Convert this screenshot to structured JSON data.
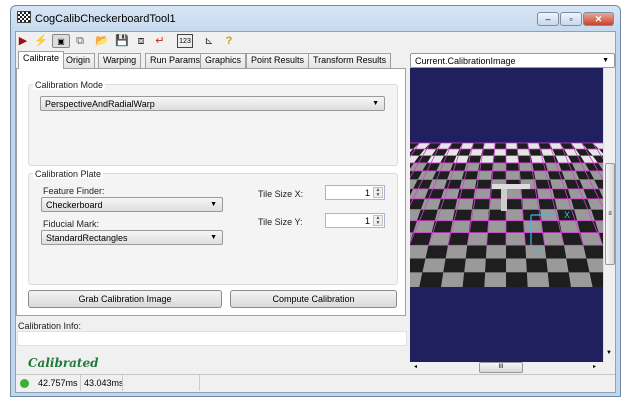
{
  "window": {
    "title": "CogCalibCheckerboardTool1",
    "icon": "checkerboard-icon",
    "buttons": [
      "minimize",
      "maximize",
      "close"
    ]
  },
  "toolbar": {
    "icons": [
      "run-icon",
      "electric-icon",
      "show-icon",
      "float-icon",
      "open-icon",
      "save-icon",
      "reset-icon",
      "import-icon",
      "numbers-icon",
      "tool-icon",
      "help-icon"
    ]
  },
  "tabs": [
    {
      "label": "Calibrate",
      "active": true
    },
    {
      "label": "Origin"
    },
    {
      "label": "Warping"
    },
    {
      "label": "Run Params"
    },
    {
      "label": "Graphics"
    },
    {
      "label": "Point Results"
    },
    {
      "label": "Transform Results"
    }
  ],
  "calibrate": {
    "mode_group": "Calibration Mode",
    "mode_value": "PerspectiveAndRadialWarp",
    "plate_group": "Calibration Plate",
    "feature_finder_label": "Feature Finder:",
    "feature_finder_value": "Checkerboard",
    "fiducial_label": "Fiducial Mark:",
    "fiducial_value": "StandardRectangles",
    "tile_x_label": "Tile Size X:",
    "tile_x_value": "1",
    "tile_y_label": "Tile Size Y:",
    "tile_y_value": "1",
    "grab_button": "Grab Calibration Image",
    "compute_button": "Compute Calibration"
  },
  "info": {
    "label": "Calibration Info:",
    "value": "",
    "status": "Calibrated",
    "status_color": "#1f7a3a"
  },
  "image": {
    "selector": "Current.CalibrationImage",
    "background": "#20205e",
    "grid_color": "#d040d0",
    "axis_color": "#40b8e8",
    "axis_x": "X",
    "axis_y": "Y"
  },
  "statusbar": {
    "indicator_color": "#3cb034",
    "time1": "42.757ms",
    "time2": "43.043ms"
  }
}
